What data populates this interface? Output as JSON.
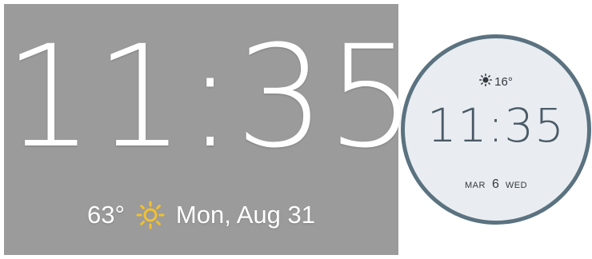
{
  "phone_clock": {
    "time": "11:35",
    "temperature": "63°",
    "weather_icon": "sun-icon",
    "date": "Mon, Aug 31",
    "colors": {
      "background": "#9b9b9b",
      "text": "#ffffff",
      "sun": "#f2c12e"
    }
  },
  "watch_face": {
    "temperature": "16°",
    "weather_icon": "sun-icon",
    "time": "11:35",
    "month": "MAR",
    "day": "6",
    "weekday": "WED",
    "colors": {
      "face": "#e9edf1",
      "ring": "#5b7280",
      "time": "#4a5a66"
    }
  }
}
